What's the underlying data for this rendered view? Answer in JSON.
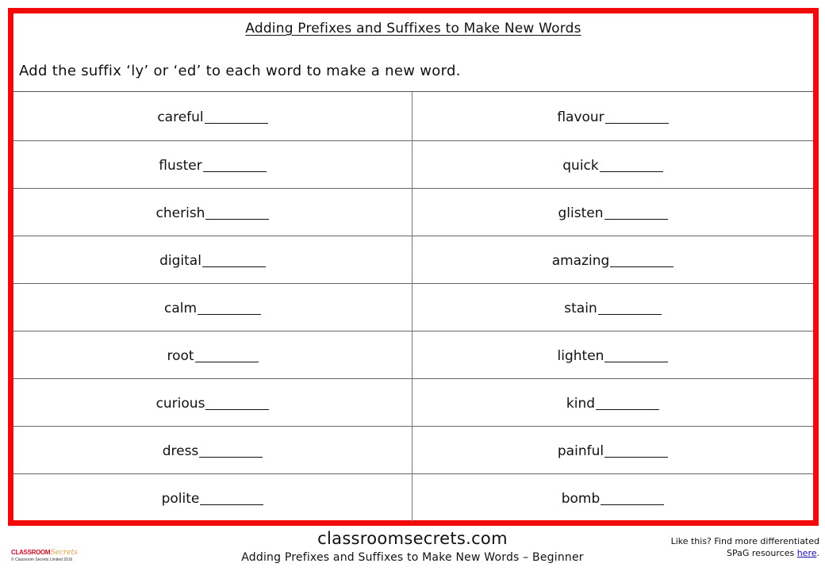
{
  "worksheet": {
    "title": "Adding Prefixes and Suffixes to Make New Words",
    "instruction": "Add the suffix ‘ly’ or ‘ed’ to each word to make a new word.",
    "rows": [
      {
        "left": "careful",
        "right": "flavour"
      },
      {
        "left": "fluster",
        "right": "quick"
      },
      {
        "left": "cherish",
        "right": "glisten"
      },
      {
        "left": "digital",
        "right": "amazing"
      },
      {
        "left": "calm",
        "right": "stain"
      },
      {
        "left": "root",
        "right": "lighten"
      },
      {
        "left": "curious",
        "right": "kind"
      },
      {
        "left": "dress",
        "right": "painful"
      },
      {
        "left": "polite",
        "right": "bomb"
      }
    ]
  },
  "footer": {
    "site": "classroomsecrets.com",
    "subtitle": "Adding Prefixes and Suffixes to Make New Words – Beginner",
    "logo_main": "CLASSROOM",
    "logo_script": "Secrets",
    "copyright": "© Classroom Secrets Limited 2016",
    "promo_line1": "Like this? Find more differentiated",
    "promo_line2_prefix": "SPaG resources ",
    "promo_link": "here",
    "promo_suffix": "."
  },
  "colors": {
    "border": "#f20a0a",
    "link": "#1a0dab"
  }
}
